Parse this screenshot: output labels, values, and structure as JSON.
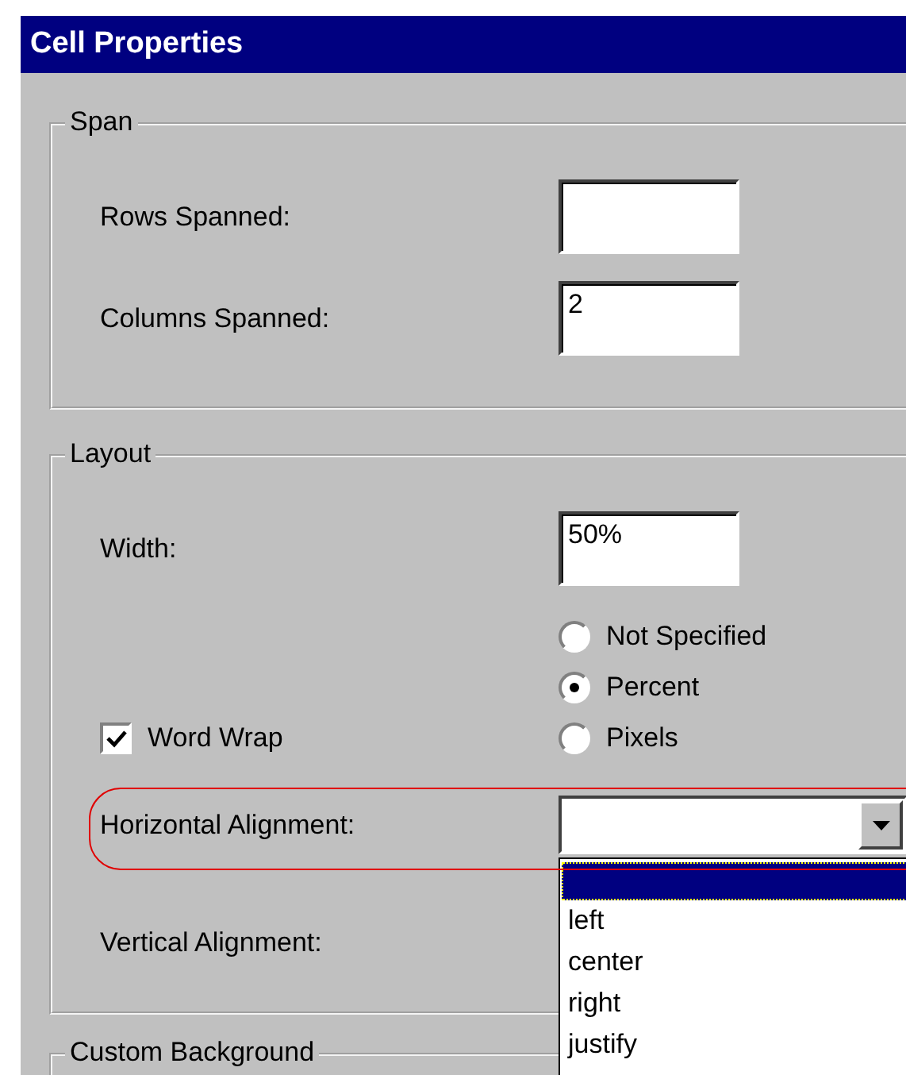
{
  "window": {
    "title": "Cell Properties"
  },
  "span": {
    "label": "Span",
    "fields": [
      {
        "label": "Rows Spanned:"
      },
      {
        "label": "Columns Spanned:",
        "value": "2"
      }
    ]
  },
  "layout": {
    "label": "Layout",
    "width": {
      "label": "Width:",
      "value": "50%"
    },
    "width_units": [
      {
        "label": "Not Specified",
        "selected": false
      },
      {
        "label": "Percent",
        "selected": true
      },
      {
        "label": "Pixels",
        "selected": false
      }
    ],
    "word_wrap": {
      "label": "Word Wrap",
      "checked": true
    },
    "horizontal_alignment": {
      "label": "Horizontal Alignment:",
      "highlighted": true,
      "dropdown": {
        "expanded": true,
        "options": [
          {
            "selected": true
          },
          {
            "label": "left",
            "selected": false
          },
          {
            "label": "center",
            "selected": false
          },
          {
            "label": "right",
            "selected": false
          },
          {
            "label": "justify",
            "selected": false
          }
        ]
      }
    },
    "vertical_alignment": {
      "label": "Vertical Alignment:"
    }
  },
  "custom_background": {
    "label": "Custom Background"
  }
}
